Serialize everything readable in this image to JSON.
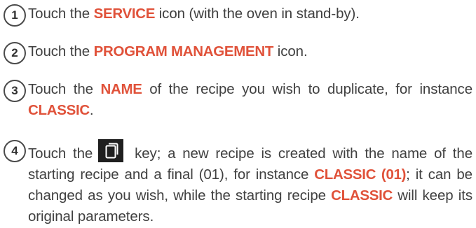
{
  "steps": [
    {
      "number": "1",
      "t1": "Touch the ",
      "hl1": "SERVICE",
      "t2": " icon (with the oven in stand-by)."
    },
    {
      "number": "2",
      "t1": "Touch the ",
      "hl1": "PROGRAM MANAGEMENT",
      "t2": " icon."
    },
    {
      "number": "3",
      "t1": "Touch the ",
      "hl1": "NAME",
      "t2": " of the recipe you wish to duplicate, for instance ",
      "hl2": "CLASSIC",
      "t3": "."
    },
    {
      "number": "4",
      "t1": "Touch the",
      "key_icon": "copy-icon",
      "t2": " key; a new recipe is created with the name of the starting recipe and a final (01), for instance ",
      "hl1": "CLASSIC (01)",
      "t3": "; it can be changed as you wish, while the starting recipe ",
      "hl2": "CLASSIC",
      "t4": " will keep its original parameters."
    }
  ],
  "colors": {
    "highlight": "#e0523a",
    "body_text": "#404040",
    "key_background": "#1f1f1f"
  }
}
